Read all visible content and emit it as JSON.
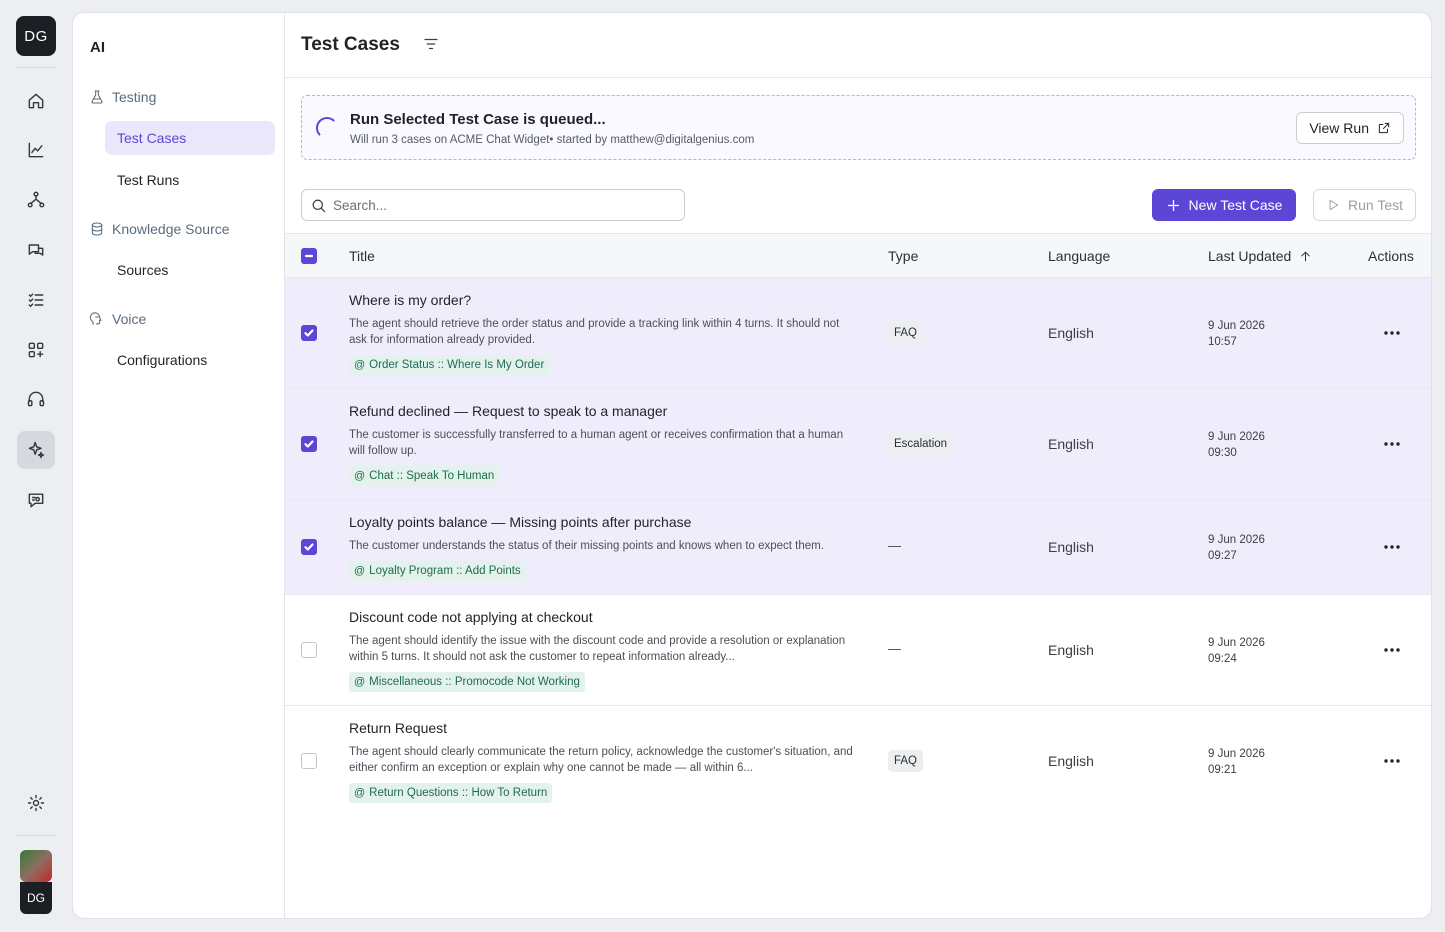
{
  "rail": {
    "logo": "DG",
    "items": [
      {
        "name": "home-icon"
      },
      {
        "name": "analytics-icon"
      },
      {
        "name": "flows-icon"
      },
      {
        "name": "conversations-icon"
      },
      {
        "name": "tasks-icon"
      },
      {
        "name": "integrations-icon"
      },
      {
        "name": "support-icon"
      },
      {
        "name": "ai-sparkle-icon",
        "active": true
      },
      {
        "name": "chat-settings-icon"
      }
    ],
    "settings_icon": "gear-icon",
    "user_initials": "DG"
  },
  "subnav": {
    "title": "AI",
    "sections": [
      {
        "label": "Testing",
        "icon": "flask-icon",
        "items": [
          {
            "label": "Test Cases",
            "active": true
          },
          {
            "label": "Test Runs"
          }
        ]
      },
      {
        "label": "Knowledge Source",
        "icon": "database-icon",
        "items": [
          {
            "label": "Sources"
          }
        ]
      },
      {
        "label": "Voice",
        "icon": "voice-icon",
        "items": [
          {
            "label": "Configurations"
          }
        ]
      }
    ]
  },
  "page": {
    "title": "Test Cases"
  },
  "banner": {
    "title": "Run Selected Test Case is queued...",
    "subtitle": "Will run 3 cases on ACME Chat Widget• started by matthew@digitalgenius.com",
    "view_run_label": "View Run"
  },
  "toolbar": {
    "search_placeholder": "Search...",
    "new_label": "New Test Case",
    "run_label": "Run Test"
  },
  "table": {
    "columns": {
      "title": "Title",
      "type": "Type",
      "language": "Language",
      "last_updated": "Last Updated",
      "actions": "Actions"
    },
    "rows": [
      {
        "title": "Where is my order?",
        "description": "The agent should retrieve the order status and provide a tracking link within 4 turns. It should not ask for information already provided.",
        "tag": "Order Status :: Where Is My Order",
        "type": "FAQ",
        "language": "English",
        "date": "9 Jun 2026",
        "time": "10:57",
        "selected": true
      },
      {
        "title": "Refund declined — Request to speak to a manager",
        "description": "The customer is successfully transferred to a human agent or receives confirmation that a human will follow up.",
        "tag": "Chat :: Speak To Human",
        "type": "Escalation",
        "language": "English",
        "date": "9 Jun 2026",
        "time": "09:30",
        "selected": true
      },
      {
        "title": "Loyalty points balance — Missing points after purchase",
        "description": "The customer understands the status of their missing points and knows when to expect them.",
        "tag": "Loyalty Program :: Add Points",
        "type": "—",
        "language": "English",
        "date": "9 Jun 2026",
        "time": "09:27",
        "selected": true
      },
      {
        "title": "Discount code not applying at checkout",
        "description": "The agent should identify the issue with the discount code and provide a resolution or explanation within 5 turns. It should not ask the customer to repeat information already...",
        "tag": "Miscellaneous :: Promocode Not Working",
        "type": "—",
        "language": "English",
        "date": "9 Jun 2026",
        "time": "09:24",
        "selected": false
      },
      {
        "title": "Return Request",
        "description": "The agent should clearly communicate the return policy, acknowledge the customer's situation, and either confirm an exception or explain why one cannot be made — all within 6...",
        "tag": "Return Questions :: How To Return",
        "type": "FAQ",
        "language": "English",
        "date": "9 Jun 2026",
        "time": "09:21",
        "selected": false
      }
    ]
  },
  "colors": {
    "accent": "#5b46d6",
    "selected_row": "#efedfb",
    "tag_bg": "#e3f3ec",
    "tag_text": "#1e6b52"
  }
}
